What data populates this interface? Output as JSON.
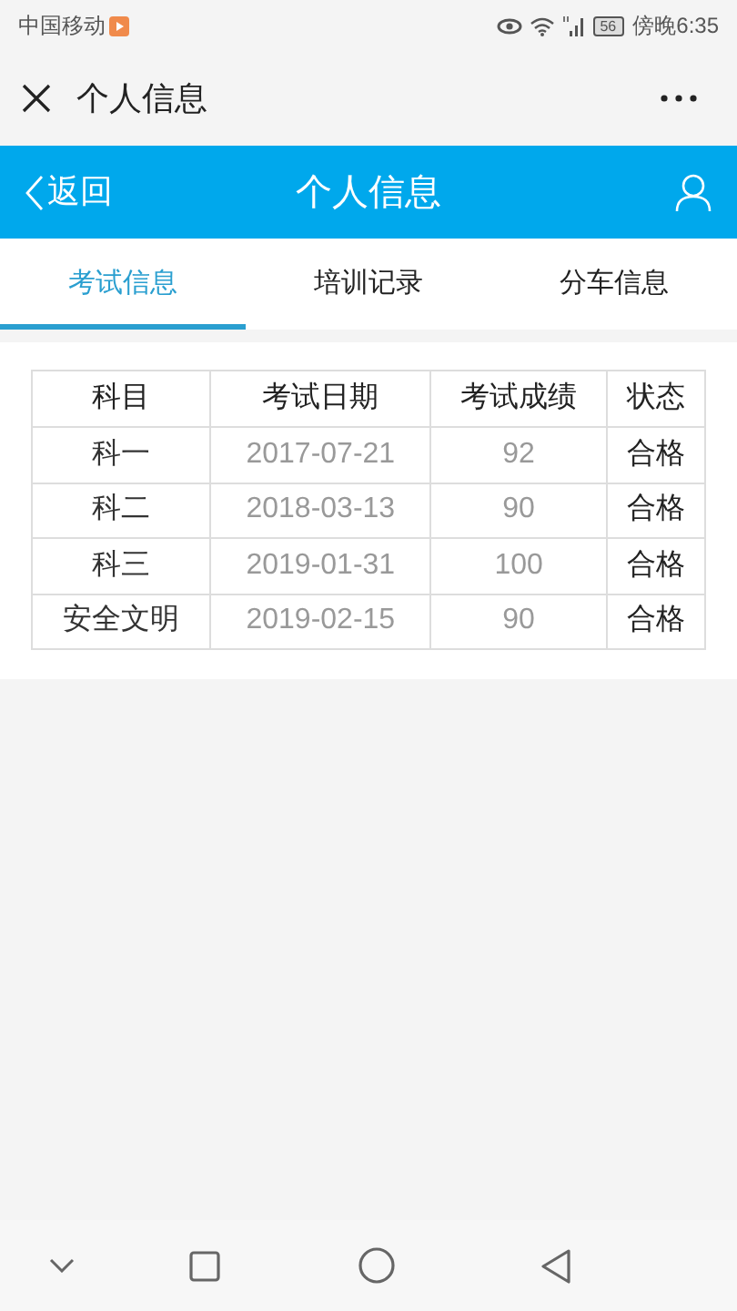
{
  "status_bar": {
    "carrier": "中国移动",
    "battery": "56",
    "time": "傍晚6:35"
  },
  "window": {
    "title": "个人信息"
  },
  "header": {
    "back": "返回",
    "title": "个人信息"
  },
  "tabs": [
    {
      "label": "考试信息",
      "selected": true
    },
    {
      "label": "培训记录",
      "selected": false
    },
    {
      "label": "分车信息",
      "selected": false
    }
  ],
  "table": {
    "columns": [
      "科目",
      "考试日期",
      "考试成绩",
      "状态"
    ],
    "rows": [
      [
        "科一",
        "2017-07-21",
        "92",
        "合格"
      ],
      [
        "科二",
        "2018-03-13",
        "90",
        "合格"
      ],
      [
        "科三",
        "2019-01-31",
        "100",
        "合格"
      ],
      [
        "安全文明",
        "2019-02-15",
        "90",
        "合格"
      ]
    ]
  }
}
